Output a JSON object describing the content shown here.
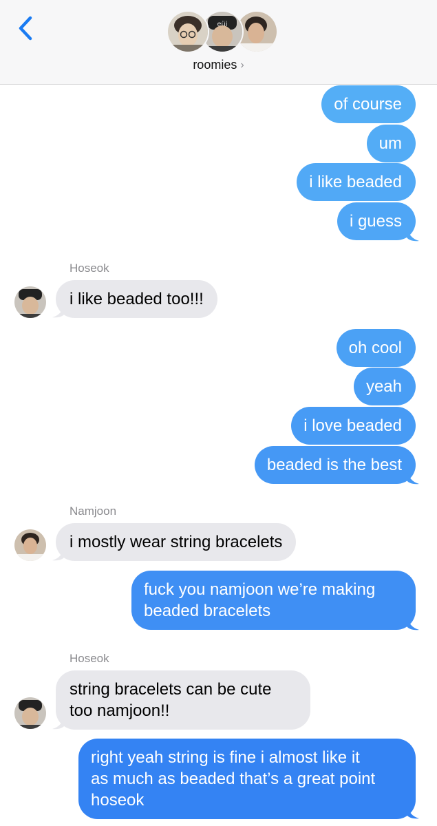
{
  "header": {
    "back_icon": "chevron-left-icon",
    "group_name": "roomies",
    "group_chevron": "›",
    "accent_color": "#1a7bf2"
  },
  "messages": [
    {
      "type": "outgoing",
      "text": "of course"
    },
    {
      "type": "outgoing",
      "text": "um"
    },
    {
      "type": "outgoing",
      "text": "i like beaded"
    },
    {
      "type": "outgoing",
      "text": "i guess"
    },
    {
      "type": "sender",
      "text": "Hoseok"
    },
    {
      "type": "incoming",
      "text": "i like beaded too!!!"
    },
    {
      "type": "outgoing",
      "text": "oh cool"
    },
    {
      "type": "outgoing",
      "text": "yeah"
    },
    {
      "type": "outgoing",
      "text": "i love beaded"
    },
    {
      "type": "outgoing",
      "text": "beaded is the best"
    },
    {
      "type": "sender",
      "text": "Namjoon"
    },
    {
      "type": "incoming",
      "text": "i mostly wear string bracelets"
    },
    {
      "type": "outgoing",
      "lines": [
        "fuck you namjoon we’re making",
        "beaded bracelets"
      ]
    },
    {
      "type": "sender",
      "text": "Hoseok"
    },
    {
      "type": "incoming",
      "lines": [
        "string bracelets can be cute",
        "too namjoon!!"
      ]
    },
    {
      "type": "outgoing",
      "lines": [
        "right yeah string is fine i almost like it",
        "as much as beaded that’s a great point",
        "hoseok"
      ]
    }
  ]
}
